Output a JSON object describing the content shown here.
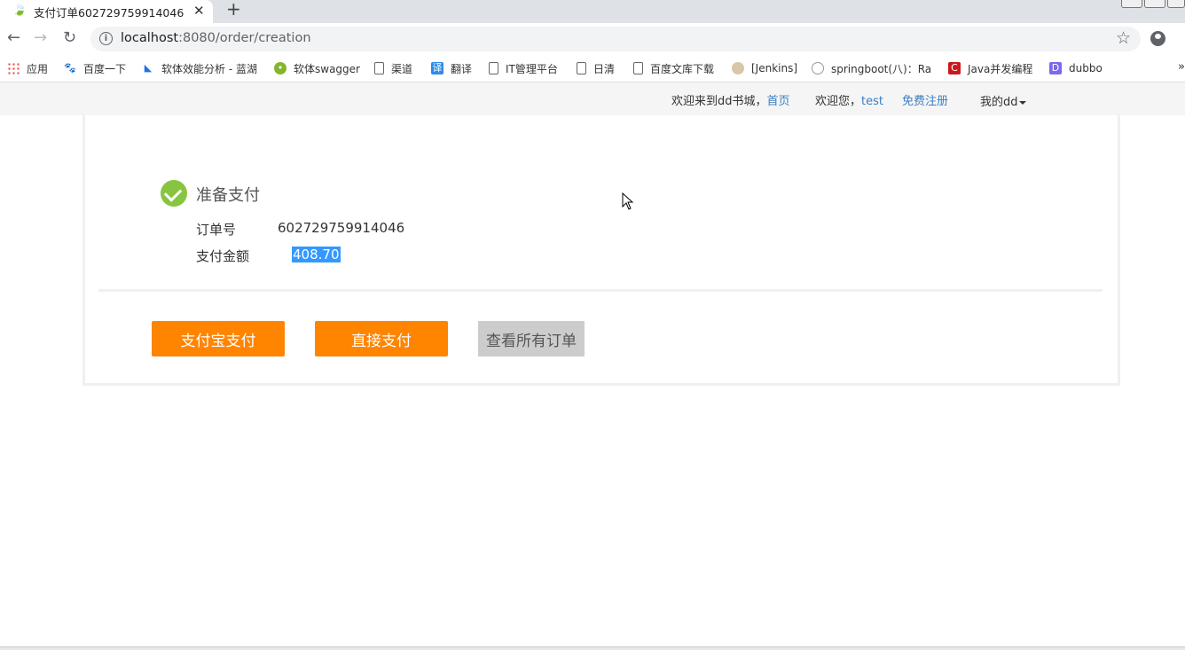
{
  "browser": {
    "tab_title": "支付订单602729759914046",
    "tab_close": "✕",
    "new_tab": "+",
    "url_host": "localhost",
    "url_rest": ":8080/order/creation",
    "info_icon": "i",
    "star": "☆",
    "bookmarks": [
      {
        "label": "应用",
        "icon": "apps-icon"
      },
      {
        "label": "百度一下",
        "icon": "baidu-icon"
      },
      {
        "label": "软体效能分析 - 蓝湖",
        "icon": "lanhu-icon"
      },
      {
        "label": "软体swagger",
        "icon": "swagger-icon"
      },
      {
        "label": "渠道",
        "icon": "page-icon"
      },
      {
        "label": "翻译",
        "icon": "translate-icon"
      },
      {
        "label": "IT管理平台",
        "icon": "page-icon"
      },
      {
        "label": "日清",
        "icon": "page-icon"
      },
      {
        "label": "百度文库下载",
        "icon": "page-icon"
      },
      {
        "label": "[Jenkins]",
        "icon": "jenkins-icon"
      },
      {
        "label": "springboot(八)：Ra",
        "icon": "springboot-icon"
      },
      {
        "label": "Java并发编程",
        "icon": "java-icon"
      },
      {
        "label": "dubbo",
        "icon": "dubbo-icon"
      }
    ],
    "bookmarks_more": "»"
  },
  "site_header": {
    "welcome": "欢迎来到dd书城，",
    "home_link": "首页",
    "greeting": "欢迎您，",
    "username": "test",
    "register_link": "免费注册",
    "my_menu": "我的dd"
  },
  "payment": {
    "status_title": "准备支付",
    "order_label": "订单号",
    "order_number": "602729759914046",
    "amount_label": "支付金额",
    "amount": "408.70",
    "buttons": {
      "alipay": "支付宝支付",
      "direct": "直接支付",
      "view_orders": "查看所有订单"
    }
  },
  "colors": {
    "accent_orange": "#ff8400",
    "success_green": "#87c540",
    "link_blue": "#3a7fc1",
    "selection_blue": "#3399ff"
  }
}
